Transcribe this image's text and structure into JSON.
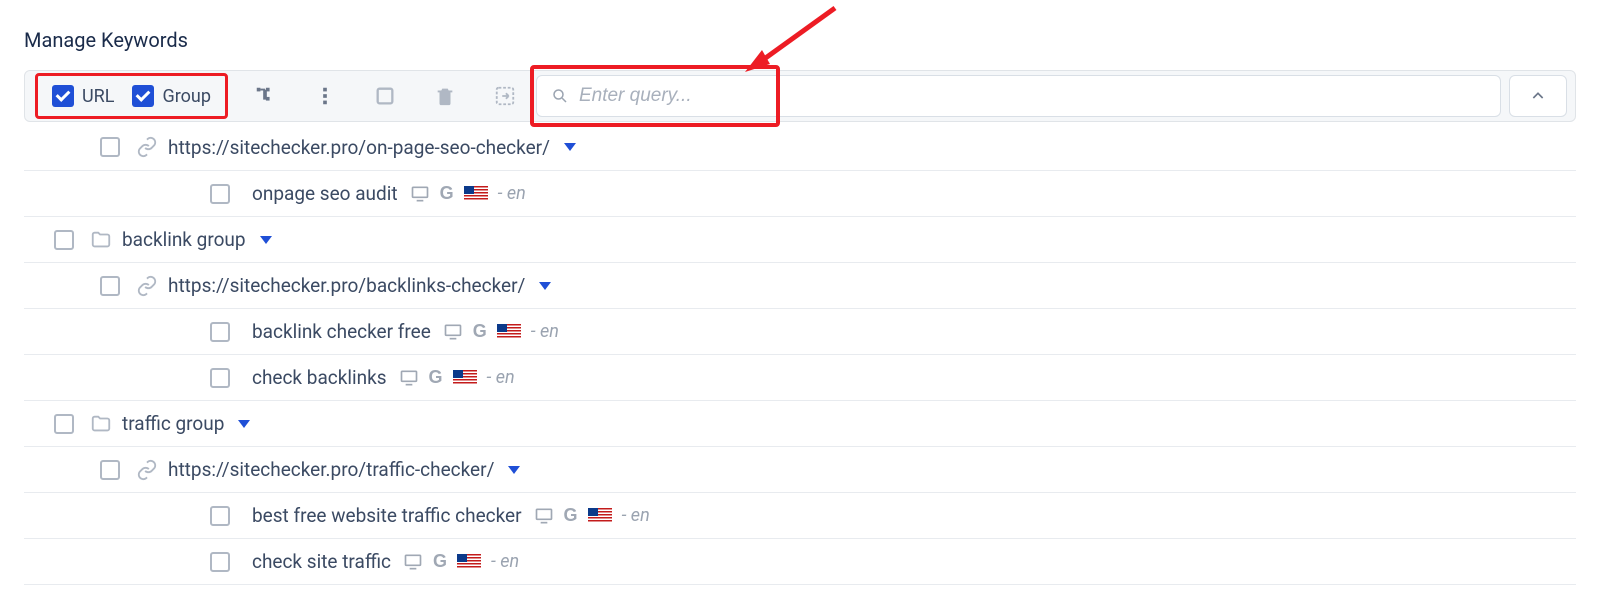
{
  "title": "Manage Keywords",
  "filters": {
    "url_label": "URL",
    "group_label": "Group"
  },
  "search": {
    "placeholder": "Enter query..."
  },
  "lang_suffix": "- en",
  "tree": [
    {
      "type": "url",
      "url": "https://sitechecker.pro/on-page-seo-checker/",
      "keywords": [
        {
          "text": "onpage seo audit"
        }
      ]
    },
    {
      "type": "group",
      "name": "backlink group",
      "urls": [
        {
          "url": "https://sitechecker.pro/backlinks-checker/",
          "keywords": [
            {
              "text": "backlink checker free"
            },
            {
              "text": "check backlinks"
            }
          ]
        }
      ]
    },
    {
      "type": "group",
      "name": "traffic group",
      "urls": [
        {
          "url": "https://sitechecker.pro/traffic-checker/",
          "keywords": [
            {
              "text": "best free website traffic checker"
            },
            {
              "text": "check site traffic"
            }
          ]
        }
      ]
    }
  ]
}
